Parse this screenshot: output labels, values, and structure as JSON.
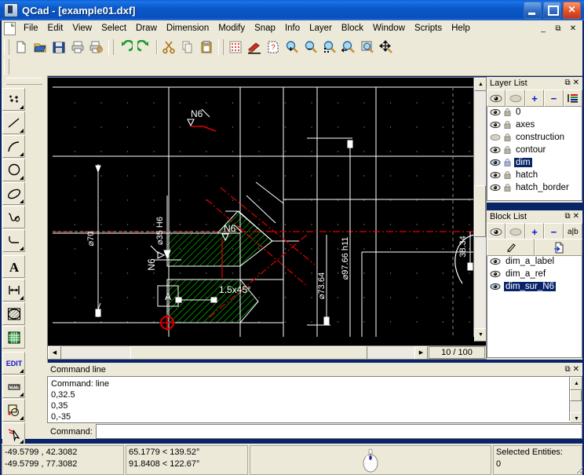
{
  "window": {
    "title": "QCad - [example01.dxf]",
    "app_icon": "qcad-app-icon",
    "minimize": "_",
    "maximize": "□",
    "close": "✕"
  },
  "mdi_buttons": {
    "minimize": "_",
    "restore": "⧉",
    "close": "✕"
  },
  "menubar": {
    "items": [
      {
        "label": "File"
      },
      {
        "label": "Edit"
      },
      {
        "label": "View"
      },
      {
        "label": "Select"
      },
      {
        "label": "Draw"
      },
      {
        "label": "Dimension"
      },
      {
        "label": "Modify"
      },
      {
        "label": "Snap"
      },
      {
        "label": "Info"
      },
      {
        "label": "Layer"
      },
      {
        "label": "Block"
      },
      {
        "label": "Window"
      },
      {
        "label": "Scripts"
      },
      {
        "label": "Help"
      }
    ]
  },
  "toolbar": {
    "groups": [
      {
        "name": "file",
        "buttons": [
          {
            "name": "new-file-icon",
            "title": "New"
          },
          {
            "name": "open-file-icon",
            "title": "Open"
          },
          {
            "name": "save-file-icon",
            "title": "Save"
          },
          {
            "name": "print-icon",
            "title": "Print"
          },
          {
            "name": "print-preview-icon",
            "title": "Print Preview"
          }
        ]
      },
      {
        "name": "edit",
        "buttons": [
          {
            "name": "undo-icon",
            "title": "Undo"
          },
          {
            "name": "redo-icon",
            "title": "Redo"
          },
          {
            "name": "cut-icon",
            "title": "Cut"
          },
          {
            "name": "copy-icon",
            "title": "Copy"
          },
          {
            "name": "paste-icon",
            "title": "Paste"
          }
        ]
      },
      {
        "name": "view",
        "buttons": [
          {
            "name": "grid-icon",
            "title": "Grid"
          },
          {
            "name": "draft-pen-icon",
            "title": "Draft mode"
          },
          {
            "name": "redraw-icon",
            "title": "Redraw"
          },
          {
            "name": "zoom-in-icon",
            "title": "Zoom In"
          },
          {
            "name": "zoom-out-icon",
            "title": "Zoom Out"
          },
          {
            "name": "zoom-auto-icon",
            "title": "Auto Zoom"
          },
          {
            "name": "zoom-previous-icon",
            "title": "Previous View"
          },
          {
            "name": "zoom-window-icon",
            "title": "Zoom Window"
          },
          {
            "name": "zoom-pan-icon",
            "title": "Pan Zoom"
          }
        ]
      }
    ]
  },
  "tool_palette": {
    "rows": [
      [
        {
          "name": "point-tool",
          "label": "points"
        },
        {
          "name": "line-tool",
          "label": "line"
        }
      ],
      [
        {
          "name": "arc-tool",
          "label": "arc"
        },
        {
          "name": "circle-tool",
          "label": "circle"
        }
      ],
      [
        {
          "name": "ellipse-tool",
          "label": "ellipse"
        },
        {
          "name": "spline-tool",
          "label": "spline"
        }
      ],
      [
        {
          "name": "polyline-tool",
          "label": "polyline"
        },
        {
          "name": "spacer",
          "label": ""
        }
      ],
      [
        {
          "name": "text-tool",
          "label": "text"
        },
        {
          "name": "dimension-tool",
          "label": "dimension"
        }
      ],
      [
        {
          "name": "hatch-tool",
          "label": "hatch"
        },
        {
          "name": "image-tool",
          "label": "image"
        }
      ],
      [
        {
          "name": "edit-tool",
          "label": "EDIT"
        },
        {
          "name": "measure-tool",
          "label": "measure"
        }
      ],
      [
        {
          "name": "snap-tool",
          "label": "snap"
        },
        {
          "name": "select-tool",
          "label": "select"
        }
      ]
    ],
    "edit_label": "EDIT"
  },
  "canvas": {
    "zoom_label": "10 / 100",
    "background": "#000000",
    "grid_color": "#808080",
    "entity_color": "#ffffff",
    "hatch_color": "#00cc00",
    "centerline_color": "#ff0000",
    "annotations": [
      {
        "text": "N6",
        "kind": "surface-finish-symbol"
      },
      {
        "text": "N6",
        "kind": "surface-finish-symbol"
      },
      {
        "text": "N6",
        "kind": "surface-finish-symbol"
      },
      {
        "text": "1.5x45°",
        "kind": "chamfer-dimension"
      },
      {
        "text": "⌀70",
        "kind": "diameter-dimension"
      },
      {
        "text": "⌀35  H6",
        "kind": "diameter-dimension"
      },
      {
        "text": "⌀73.64",
        "kind": "diameter-dimension"
      },
      {
        "text": "⌀97.66  h11",
        "kind": "diameter-dimension"
      },
      {
        "text": "38.34",
        "kind": "linear-dimension"
      },
      {
        "text": "A",
        "kind": "datum-label"
      }
    ]
  },
  "layer_list": {
    "title": "Layer List",
    "buttons": [
      {
        "name": "show-all-layers-button",
        "label": "show-all-icon"
      },
      {
        "name": "hide-all-layers-button",
        "label": "hide-all-icon"
      },
      {
        "name": "add-layer-button",
        "label": "+"
      },
      {
        "name": "remove-layer-button",
        "label": "−"
      },
      {
        "name": "edit-layer-button",
        "label": "layer-properties-icon"
      }
    ],
    "items": [
      {
        "name": "0",
        "visible": true,
        "locked": true,
        "selected": false
      },
      {
        "name": "axes",
        "visible": true,
        "locked": true,
        "selected": false
      },
      {
        "name": "construction",
        "visible": false,
        "locked": true,
        "selected": false
      },
      {
        "name": "contour",
        "visible": true,
        "locked": true,
        "selected": false
      },
      {
        "name": "dim",
        "visible": true,
        "locked": true,
        "selected": true
      },
      {
        "name": "hatch",
        "visible": true,
        "locked": true,
        "selected": false
      },
      {
        "name": "hatch_border",
        "visible": true,
        "locked": true,
        "selected": false
      }
    ]
  },
  "block_list": {
    "title": "Block List",
    "buttons_row1": [
      {
        "name": "show-all-blocks-button",
        "label": "show-all-icon"
      },
      {
        "name": "hide-all-blocks-button",
        "label": "hide-all-icon"
      },
      {
        "name": "add-block-button",
        "label": "+"
      },
      {
        "name": "remove-block-button",
        "label": "−"
      },
      {
        "name": "rename-block-button",
        "label": "a|b"
      }
    ],
    "buttons_row2": [
      {
        "name": "edit-block-button",
        "label": "pencil-icon"
      },
      {
        "name": "insert-block-button",
        "label": "insert-block-icon"
      }
    ],
    "items": [
      {
        "name": "dim_a_label",
        "visible": true,
        "selected": false
      },
      {
        "name": "dim_a_ref",
        "visible": true,
        "selected": false
      },
      {
        "name": "dim_sur_N6",
        "visible": true,
        "selected": true
      }
    ]
  },
  "command_line": {
    "title": "Command line",
    "history": [
      "Command: line",
      "0,32.5",
      "0,35",
      "0,-35"
    ],
    "prompt_label": "Command:",
    "input_value": "",
    "input_placeholder": ""
  },
  "status_bar": {
    "abs_coord_1": "-49.5799 , 42.3082",
    "abs_coord_2": "-49.5799 , 77.3082",
    "rel_coord_1": "65.1779 < 139.52°",
    "rel_coord_2": "91.8408 < 122.67°",
    "mouse_hint_icon": "mouse-widget-icon",
    "selected_label": "Selected Entities:",
    "selected_count": "0"
  }
}
